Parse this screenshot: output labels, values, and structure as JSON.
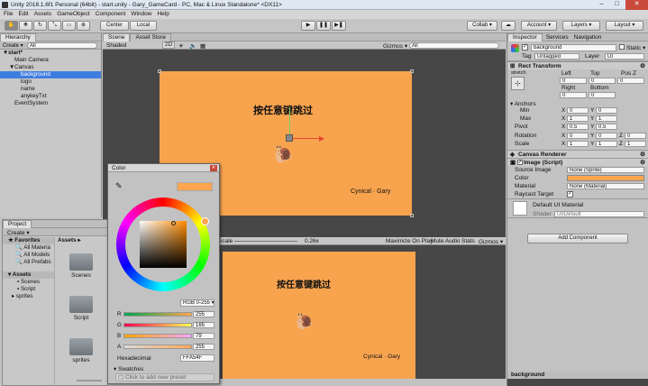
{
  "window": {
    "title": "Unity 2018.1.6f1 Personal (64bit) - start.unity - Gary_GameCard - PC, Mac & Linux Standalone* <DX11>",
    "min": "–",
    "max": "□",
    "close": "✕"
  },
  "menu": [
    "File",
    "Edit",
    "Assets",
    "GameObject",
    "Component",
    "Window",
    "Help"
  ],
  "toolbar": {
    "center": "Center",
    "local": "Local",
    "collab": "Collab ▾",
    "account": "Account ▾",
    "layers": "Layers ▾",
    "layout": "Layout ▾"
  },
  "hierarchy": {
    "tab": "Hierarchy",
    "create": "Create ▾",
    "search": "All",
    "items": [
      {
        "label": "start*",
        "depth": 0,
        "arrow": "▼",
        "selected": false,
        "bold": true
      },
      {
        "label": "Main Camera",
        "depth": 1,
        "arrow": "",
        "selected": false
      },
      {
        "label": "Canvas",
        "depth": 1,
        "arrow": "▼",
        "selected": false
      },
      {
        "label": "background",
        "depth": 2,
        "arrow": "",
        "selected": true
      },
      {
        "label": "logo",
        "depth": 2,
        "arrow": "",
        "selected": false
      },
      {
        "label": "name",
        "depth": 2,
        "arrow": "",
        "selected": false
      },
      {
        "label": "anykeyTxt",
        "depth": 2,
        "arrow": "",
        "selected": false
      },
      {
        "label": "EventSystem",
        "depth": 1,
        "arrow": "",
        "selected": false
      }
    ]
  },
  "scene": {
    "tabs": [
      "Scene",
      "Asset Store"
    ],
    "shading": "Shaded",
    "mode2d": "2D",
    "gizmos": "Gizmos ▾",
    "search": "All",
    "title_text": "按任意键跳过",
    "credit": "Cynical · Gary"
  },
  "game": {
    "scale_label": "Scale",
    "scale_value": "0.26x",
    "maximize": "Maximize On Play",
    "mute": "Mute Audio",
    "stats": "Stats",
    "gizmos": "Gizmos ▾",
    "title_text": "按任意键跳过",
    "credit": "Cynical · Gary"
  },
  "project": {
    "tab": "Project",
    "create": "Create ▾",
    "favorites": "Favorites",
    "fav_items": [
      "All Materia",
      "All Models",
      "All Prefabs"
    ],
    "assets_label": "Assets",
    "tree": [
      "Scenes",
      "Script",
      "sprites"
    ],
    "breadcrumb": "Assets ▸",
    "folders": [
      "Scenes",
      "Script",
      "sprites"
    ]
  },
  "color_picker": {
    "title": "Color",
    "close": "✕",
    "mode": "RGB 0-255 ▾",
    "channels": [
      {
        "name": "R",
        "value": "255"
      },
      {
        "name": "G",
        "value": "165"
      },
      {
        "name": "B",
        "value": "79"
      },
      {
        "name": "A",
        "value": "255"
      }
    ],
    "hex_label": "Hexadecimal",
    "hex_value": "FFA54F",
    "swatches_label": "Swatches",
    "add_preset": "Click to add new preset",
    "color": "#ffa54f"
  },
  "inspector": {
    "tabs": [
      "Inspector",
      "Services",
      "Navigation"
    ],
    "object_name": "background",
    "static_label": "Static ▾",
    "tag_label": "Tag",
    "tag_value": "Untagged",
    "layer_label": "Layer",
    "layer_value": "UI",
    "rect": {
      "title": "Rect Transform",
      "stretch": "stretch",
      "cols1": [
        "Left",
        "Top",
        "Pos Z"
      ],
      "vals1": [
        "0",
        "0",
        "0"
      ],
      "cols2": [
        "Right",
        "Bottom"
      ],
      "vals2": [
        "0",
        "0"
      ],
      "anchors": "Anchors",
      "min_label": "Min",
      "min": [
        "0",
        "0"
      ],
      "max_label": "Max",
      "max": [
        "1",
        "1"
      ],
      "pivot_label": "Pivot",
      "pivot": [
        "0.5",
        "0.5"
      ],
      "rotation_label": "Rotation",
      "rotation": [
        "0",
        "0",
        "0"
      ],
      "scale_label": "Scale",
      "scale": [
        "1",
        "1",
        "1"
      ],
      "x": "X",
      "y": "Y",
      "z": "Z"
    },
    "canvas_renderer": "Canvas Renderer",
    "image": {
      "title": "Image (Script)",
      "source_label": "Source Image",
      "source_value": "None (Sprite)",
      "color_label": "Color",
      "material_label": "Material",
      "material_value": "None (Material)",
      "raycast_label": "Raycast Target"
    },
    "material": {
      "name": "Default UI Material",
      "shader_label": "Shader",
      "shader_value": "UI/Default"
    },
    "add_component": "Add Component",
    "footer": "background"
  },
  "colors": {
    "scene_bg": "#474747",
    "canvas": "#f8a44f",
    "selection": "#3e7de0"
  }
}
